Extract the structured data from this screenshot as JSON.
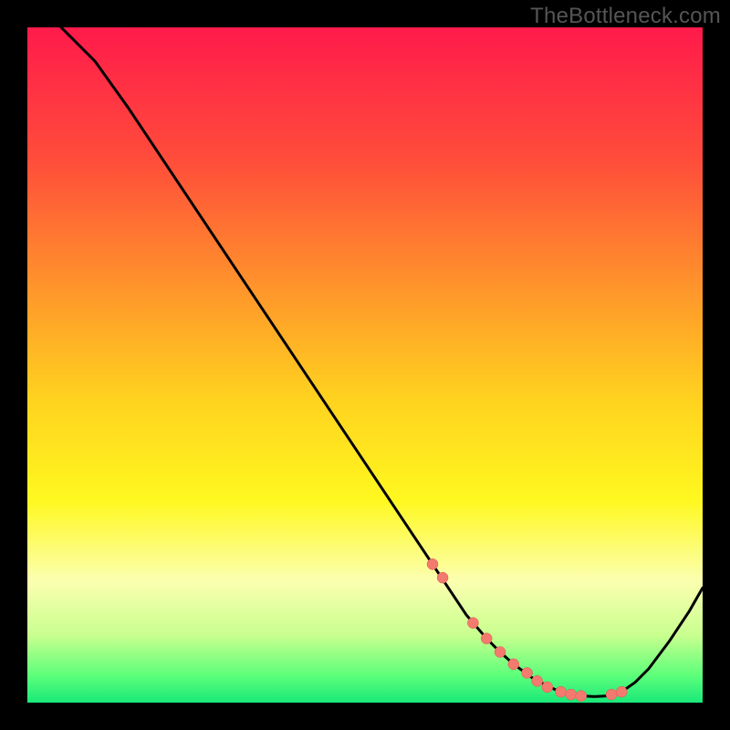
{
  "watermark": "TheBottleneck.com",
  "chart_data": {
    "type": "line",
    "title": "",
    "xlabel": "",
    "ylabel": "",
    "xlim": [
      0,
      100
    ],
    "ylim": [
      0,
      100
    ],
    "grid": false,
    "legend": false,
    "series": [
      {
        "name": "curve",
        "x": [
          5,
          10,
          15,
          20,
          25,
          30,
          35,
          40,
          45,
          50,
          55,
          60,
          63,
          65,
          68,
          70,
          72,
          75,
          78,
          80,
          82,
          84,
          86,
          88,
          90,
          92,
          95,
          98,
          100
        ],
        "y": [
          100,
          95,
          88,
          80.5,
          73,
          65.5,
          58,
          50.5,
          43,
          35.5,
          28,
          20.5,
          16,
          13,
          9.5,
          7.5,
          5.7,
          3.5,
          2.0,
          1.3,
          1.0,
          0.9,
          1.0,
          1.6,
          3.0,
          5.0,
          9.0,
          13.5,
          17
        ]
      }
    ],
    "markers": {
      "name": "dots",
      "color": "#f37a6f",
      "points_x": [
        60,
        61.5,
        66,
        68,
        70,
        72,
        74,
        75.5,
        77,
        79,
        80.5,
        82,
        86.5,
        88
      ],
      "points_y": [
        20.5,
        18.5,
        11.8,
        9.5,
        7.5,
        5.7,
        4.4,
        3.2,
        2.3,
        1.6,
        1.2,
        1.0,
        1.2,
        1.6
      ]
    },
    "gradient": {
      "stops": [
        {
          "offset": 0.0,
          "color": "#ff1a4b"
        },
        {
          "offset": 0.2,
          "color": "#ff4e3a"
        },
        {
          "offset": 0.4,
          "color": "#ff9a2a"
        },
        {
          "offset": 0.55,
          "color": "#ffd21f"
        },
        {
          "offset": 0.7,
          "color": "#fff81f"
        },
        {
          "offset": 0.82,
          "color": "#fbffb0"
        },
        {
          "offset": 0.9,
          "color": "#c9ff8f"
        },
        {
          "offset": 0.96,
          "color": "#5cff7a"
        },
        {
          "offset": 1.0,
          "color": "#19e97a"
        }
      ]
    }
  }
}
